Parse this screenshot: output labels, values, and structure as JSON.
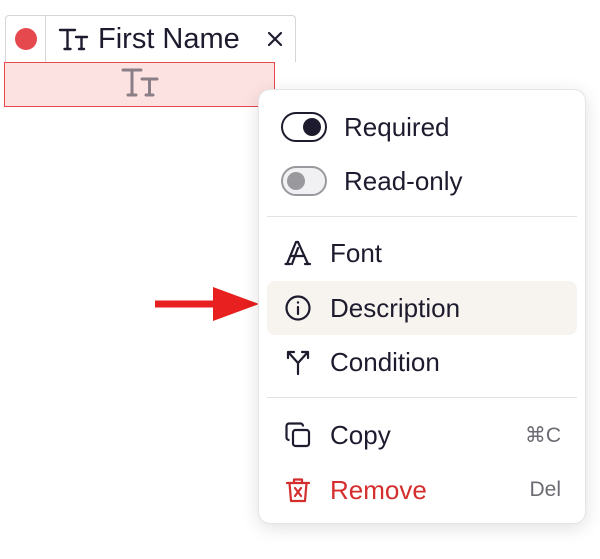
{
  "field": {
    "status_color": "#e5484d",
    "type_icon": "text-type-icon",
    "label": "First Name",
    "close_icon": "close-icon",
    "highlight_color": "#fde2e2",
    "border_color": "#e5484d"
  },
  "annotation": {
    "arrow_color": "#e8201f",
    "points_to": "Description"
  },
  "menu": {
    "toggles": [
      {
        "label": "Required",
        "state": "on"
      },
      {
        "label": "Read-only",
        "state": "off"
      }
    ],
    "items": [
      {
        "icon": "font-icon",
        "label": "Font"
      },
      {
        "icon": "info-icon",
        "label": "Description"
      },
      {
        "icon": "condition-icon",
        "label": "Condition"
      }
    ],
    "actions": [
      {
        "icon": "copy-icon",
        "label": "Copy",
        "shortcut": "⌘C"
      },
      {
        "icon": "trash-icon",
        "label": "Remove",
        "shortcut": "Del"
      }
    ],
    "danger_color": "#d42e2e"
  }
}
